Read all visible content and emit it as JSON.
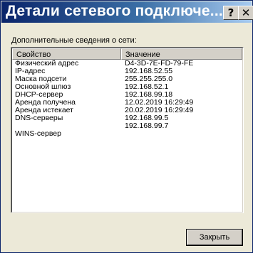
{
  "window": {
    "title": "Детали сетевого подключе...",
    "help_glyph": "?",
    "close_glyph": "✕"
  },
  "section_label": "Дополнительные сведения о сети:",
  "table": {
    "columns": [
      "Свойство",
      "Значение"
    ],
    "rows": [
      {
        "property": "Физический адрес",
        "value": "D4-3D-7E-FD-79-FE"
      },
      {
        "property": "IP-адрес",
        "value": "192.168.52.55"
      },
      {
        "property": "Маска подсети",
        "value": "255.255.255.0"
      },
      {
        "property": "Основной шлюз",
        "value": "192.168.52.1"
      },
      {
        "property": "DHCP-сервер",
        "value": "192.168.99.18"
      },
      {
        "property": "Аренда получена",
        "value": "12.02.2019 16:29:49"
      },
      {
        "property": "Аренда истекает",
        "value": "20.02.2019 16:29:49"
      },
      {
        "property": "DNS-серверы",
        "value": "192.168.99.5"
      },
      {
        "property": "",
        "value": "192.168.99.7"
      },
      {
        "property": "WINS-сервер",
        "value": ""
      }
    ]
  },
  "buttons": {
    "close_label": "Закрыть"
  }
}
